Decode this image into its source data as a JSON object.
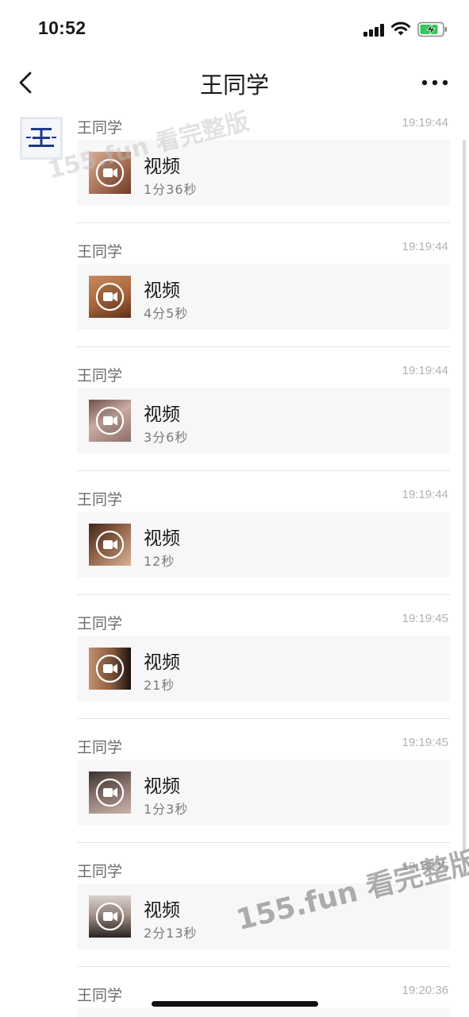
{
  "status": {
    "time": "10:52"
  },
  "nav": {
    "title": "王同学"
  },
  "watermark": {
    "text": "155.fun 看完整版"
  },
  "records": [
    {
      "sender": "王同学",
      "time": "19:19:44",
      "title": "视频",
      "duration": "1分36秒",
      "thumb_color": "#b07a5e"
    },
    {
      "sender": "王同学",
      "time": "19:19:44",
      "title": "视频",
      "duration": "4分5秒",
      "thumb_color": "#a5643c"
    },
    {
      "sender": "王同学",
      "time": "19:19:44",
      "title": "视频",
      "duration": "3分6秒",
      "thumb_color": "#a58f86"
    },
    {
      "sender": "王同学",
      "time": "19:19:44",
      "title": "视频",
      "duration": "12秒",
      "thumb_color": "#8a5a3e"
    },
    {
      "sender": "王同学",
      "time": "19:19:45",
      "title": "视频",
      "duration": "21秒",
      "thumb_color": "#7a5538"
    },
    {
      "sender": "王同学",
      "time": "19:19:45",
      "title": "视频",
      "duration": "1分3秒",
      "thumb_color": "#6f5a55"
    },
    {
      "sender": "王同学",
      "time": "19:19:45",
      "title": "视频",
      "duration": "2分13秒",
      "thumb_color": "#8f7f77"
    },
    {
      "sender": "王同学",
      "time": "19:20:36",
      "title": "",
      "duration": "",
      "thumb_color": "#f7f7f7"
    }
  ]
}
